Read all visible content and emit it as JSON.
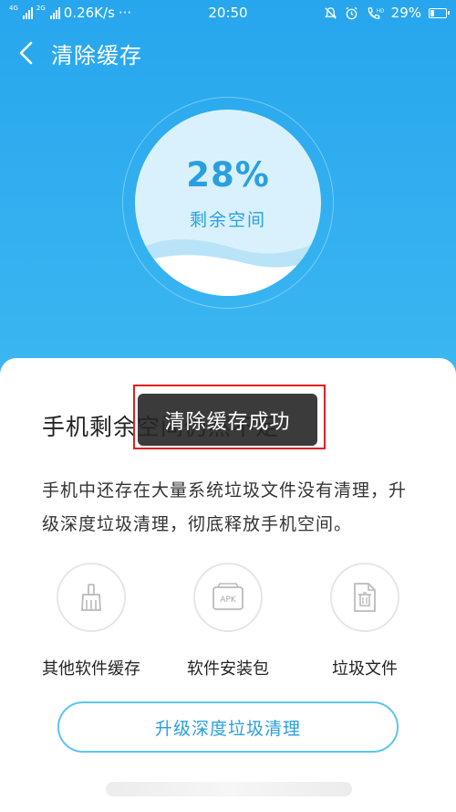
{
  "status_bar": {
    "network_left": "4G",
    "network_left_sup": "4G",
    "network_right": "2G",
    "speed": "0.26K/s",
    "more": "···",
    "time": "20:50",
    "battery": "29%",
    "battery_level": 0.29,
    "icons": [
      "alarm-off-icon",
      "alarm-clock-icon",
      "hd-call-icon",
      "battery-icon"
    ]
  },
  "header": {
    "title": "清除缓存",
    "back_icon": "chevron-left-icon"
  },
  "storage": {
    "percent": "28%",
    "label": "剩余空间"
  },
  "card": {
    "title": "手机剩余空间仍然不足",
    "description": "手机中还存在大量系统垃圾文件没有清理，升级深度垃圾清理，彻底释放手机空间。",
    "features": [
      {
        "label": "其他软件缓存",
        "icon": "broom-icon"
      },
      {
        "label": "软件安装包",
        "icon": "apk-package-icon",
        "icon_text": "APK"
      },
      {
        "label": "垃圾文件",
        "icon": "trash-file-icon"
      }
    ],
    "cta_label": "升级深度垃圾清理"
  },
  "toast": {
    "message": "清除缓存成功"
  },
  "colors": {
    "header_blue": "#27a6ee",
    "accent_blue": "#2a9fe0",
    "highlight_red": "#e02020"
  }
}
